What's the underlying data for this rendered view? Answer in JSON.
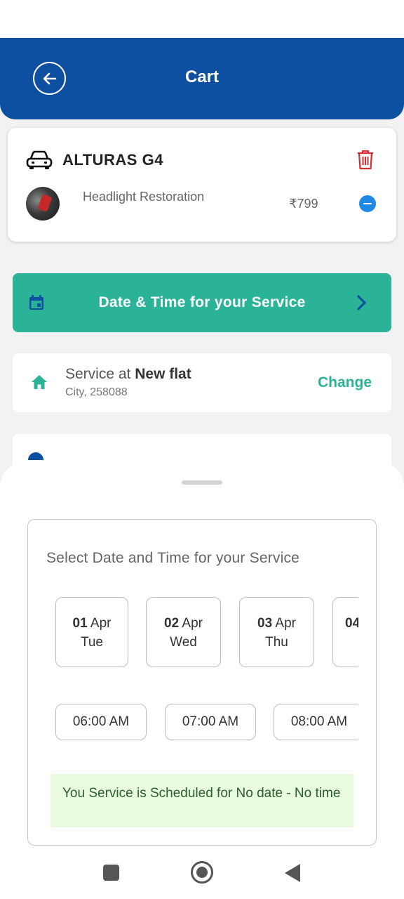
{
  "header": {
    "title": "Cart"
  },
  "cart": {
    "car_name": "ALTURAS G4",
    "item_name": "Headlight Restoration",
    "item_price": "₹799"
  },
  "datetime_bar": {
    "label": "Date & Time for your Service"
  },
  "address": {
    "prefix": "Service at ",
    "name": "New flat",
    "line": "City, 258088",
    "change_label": "Change"
  },
  "picker": {
    "title": "Select Date and Time for your Service",
    "dates": [
      {
        "day": "01",
        "month": "Apr",
        "weekday": "Tue"
      },
      {
        "day": "02",
        "month": "Apr",
        "weekday": "Wed"
      },
      {
        "day": "03",
        "month": "Apr",
        "weekday": "Thu"
      },
      {
        "day": "04",
        "month": "",
        "weekday": ""
      }
    ],
    "times": [
      "06:00 AM",
      "07:00 AM",
      "08:00 AM"
    ],
    "schedule_message": "You Service is Scheduled for No date - No time"
  },
  "colors": {
    "header": "#0d4fa0",
    "accent": "#2bb397",
    "delete": "#d32f2f",
    "remove": "#1e88e5"
  },
  "icons": [
    "back-arrow-icon",
    "car-icon",
    "trash-icon",
    "minus-icon",
    "calendar-icon",
    "chevron-right-icon",
    "home-icon"
  ]
}
